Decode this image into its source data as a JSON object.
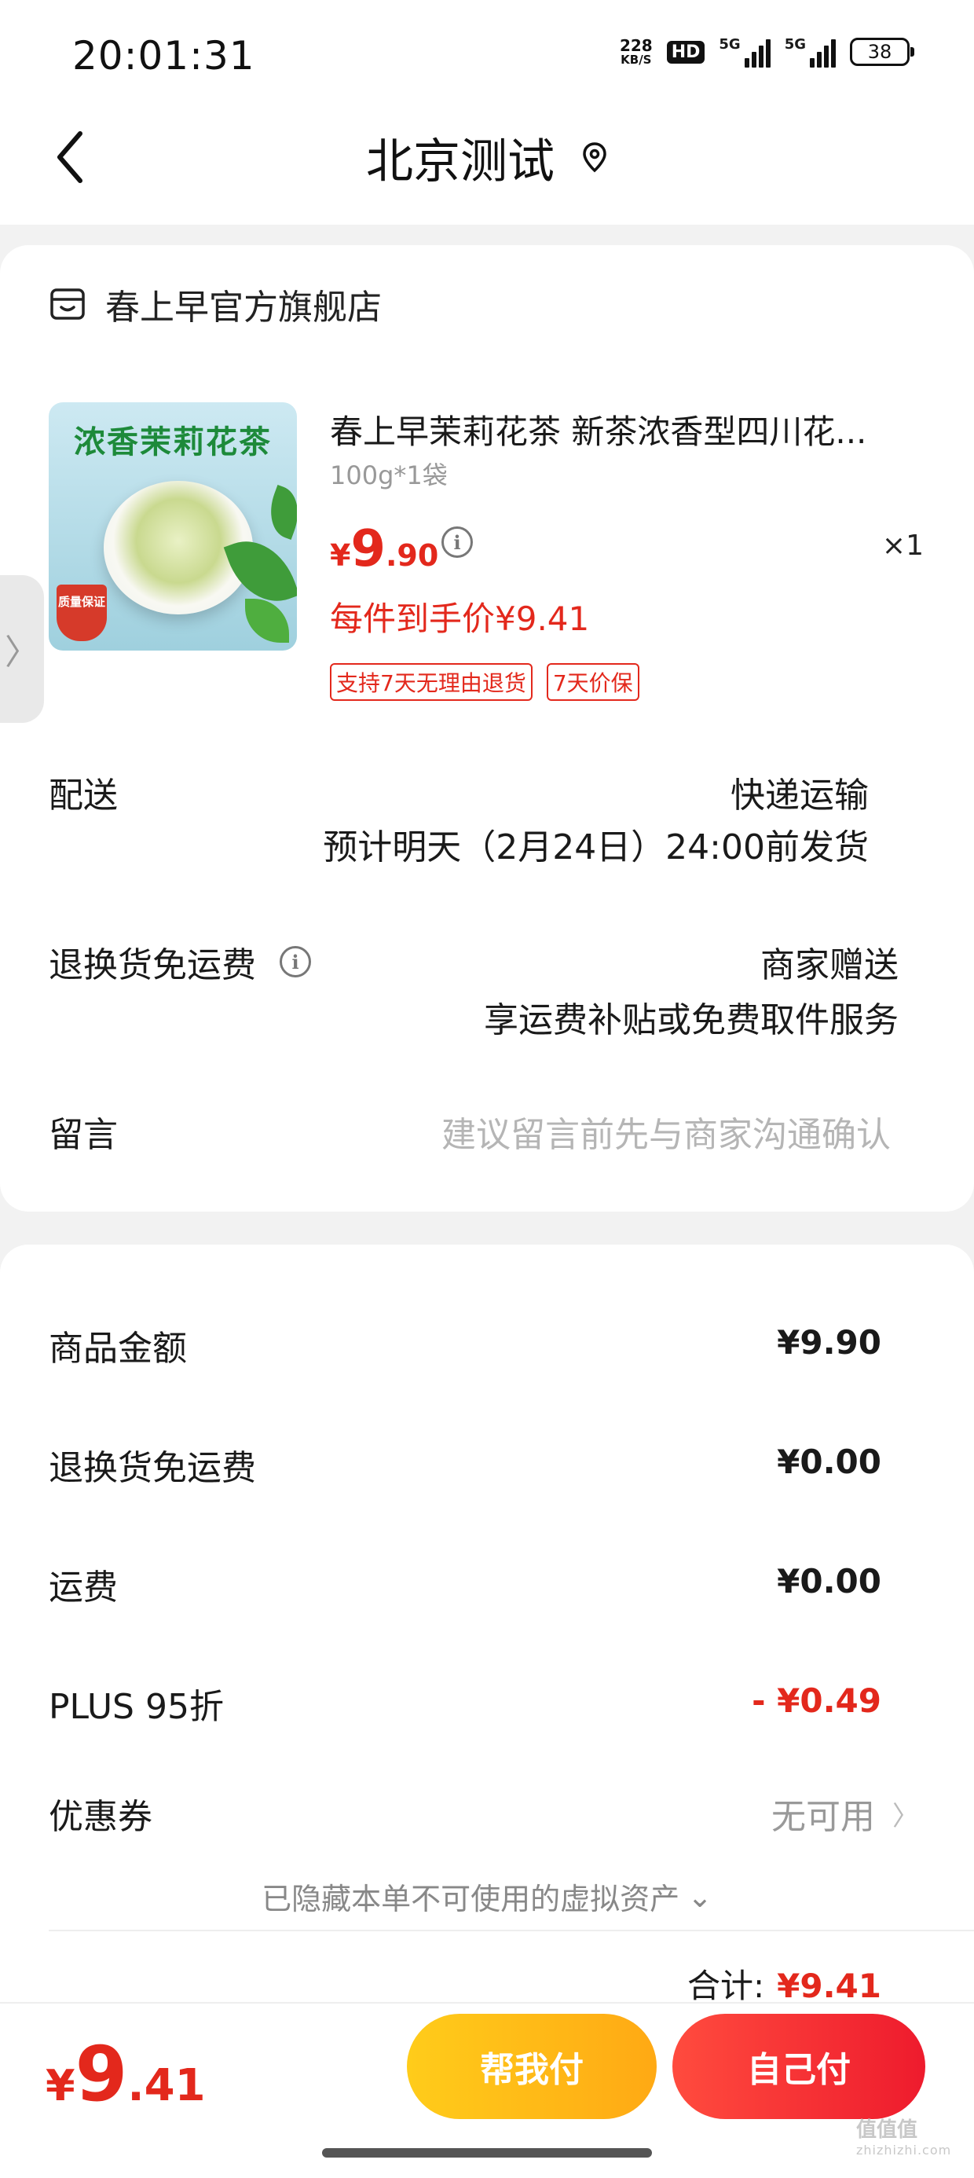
{
  "status_bar": {
    "time": "20:01:31",
    "net_speed_value": "228",
    "net_speed_unit": "KB/S",
    "hd_label": "HD",
    "signal1_label": "5G",
    "signal2_label": "5G",
    "battery": "38"
  },
  "header": {
    "title": "北京测试",
    "back_icon": "chevron-left-icon",
    "location_icon": "location-pin-icon"
  },
  "store": {
    "name": "春上早官方旗舰店",
    "icon": "store-icon"
  },
  "product": {
    "image_text": "浓香茉莉花茶",
    "image_badge": "质量保证",
    "title": "春上早茉莉花茶 新茶浓香型四川花...",
    "spec": "100g*1袋",
    "price_currency": "¥",
    "price_int": "9",
    "price_dec": ".90",
    "quantity": "×1",
    "unit_price": "每件到手价¥9.41",
    "tags": [
      "支持7天无理由退货",
      "7天价保"
    ]
  },
  "side_tab": {
    "glyph": "〉"
  },
  "delivery": {
    "label": "配送",
    "method": "快递运输",
    "eta": "预计明天（2月24日）24:00前发货"
  },
  "return_shipping": {
    "label": "退换货免运费",
    "value": "商家赠送",
    "desc": "享运费补贴或免费取件服务"
  },
  "message": {
    "label": "留言",
    "placeholder": "建议留言前先与商家沟通确认"
  },
  "summary": {
    "rows": [
      {
        "label": "商品金额",
        "value": "¥9.90",
        "color": "#1a1a1a"
      },
      {
        "label": "退换货免运费",
        "value": "¥0.00",
        "color": "#1a1a1a"
      },
      {
        "label": "运费",
        "value": "¥0.00",
        "color": "#1a1a1a"
      },
      {
        "label": "PLUS 95折",
        "value": "- ¥0.49",
        "color": "#e3281c"
      }
    ],
    "coupon_label": "优惠券",
    "coupon_value": "无可用",
    "coupon_chevron": "〉",
    "hidden_assets": "已隐藏本单不可使用的虚拟资产",
    "hidden_chevron": "⌄",
    "total_label": "合计:",
    "total_value": "¥9.41"
  },
  "footer": {
    "total_currency": "¥",
    "total_int": "9",
    "total_dec": ".41",
    "help_pay": "帮我付",
    "self_pay": "自己付",
    "watermark": "值值值",
    "watermark_sub": "zhizhizhi.com"
  },
  "colors": {
    "accent_red": "#e3281c",
    "help_button": "#ffb816",
    "self_button": "#ef2a33"
  }
}
